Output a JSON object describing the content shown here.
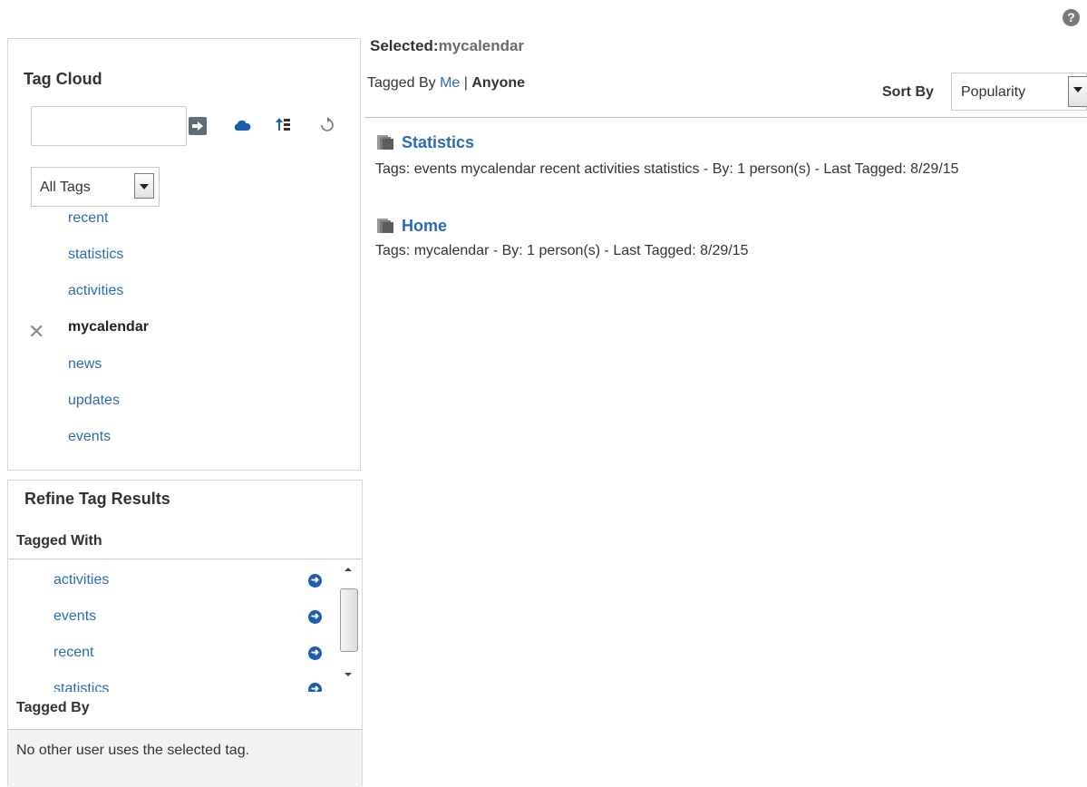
{
  "help": {
    "symbol": "?"
  },
  "tag_cloud": {
    "title": "Tag Cloud",
    "search_value": "",
    "filter_selected": "All Tags",
    "tags": [
      "recent",
      "statistics",
      "activities",
      "mycalendar",
      "news",
      "updates",
      "events"
    ],
    "selected_tag": "mycalendar"
  },
  "refine": {
    "title": "Refine Tag Results",
    "tagged_with_label": "Tagged With",
    "tagged_with": [
      "activities",
      "events",
      "recent",
      "statistics"
    ],
    "tagged_by_label": "Tagged By",
    "tagged_by_message": "No other user uses the selected tag."
  },
  "main": {
    "selected_label": "Selected:",
    "selected_value": "mycalendar",
    "tagged_by_prefix": "Tagged By",
    "tagged_by_me": "Me",
    "tagged_by_sep": "|",
    "tagged_by_anyone": "Anyone",
    "sort_label": "Sort By",
    "sort_value": "Popularity",
    "results": [
      {
        "title": "Statistics",
        "meta": "Tags: events mycalendar recent activities statistics - By: 1 person(s) - Last Tagged: 8/29/15"
      },
      {
        "title": "Home",
        "meta": "Tags: mycalendar - By: 1 person(s) - Last Tagged: 8/29/15"
      }
    ]
  },
  "colors": {
    "link": "#2d6bb3",
    "accent": "#1c5fae"
  }
}
